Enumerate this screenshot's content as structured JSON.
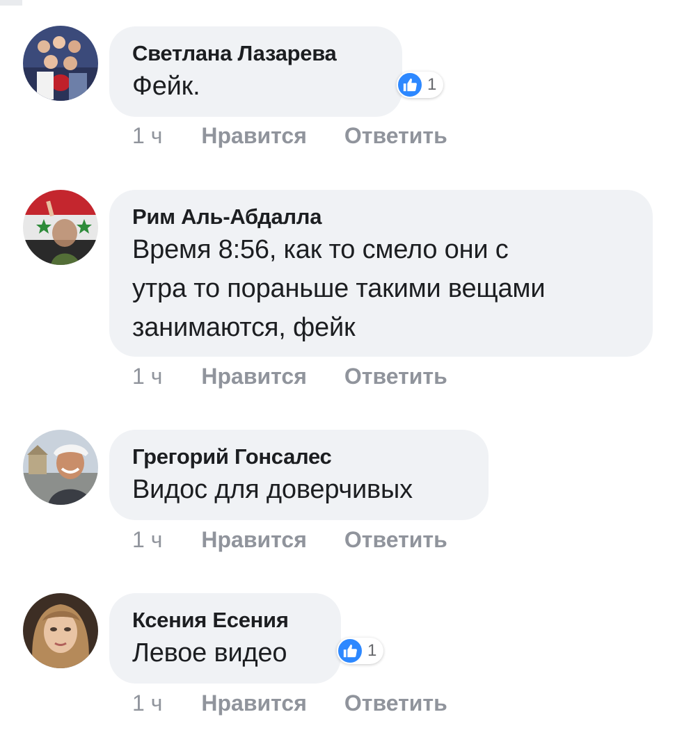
{
  "comments": [
    {
      "author": "Светлана Лазарева",
      "text": "Фейк.",
      "time": "1 ч",
      "like_label": "Нравится",
      "reply_label": "Ответить",
      "reactions": "1"
    },
    {
      "author": "Рим Аль-Абдалла",
      "text_lines": [
        "Время 8:56, как то смело они с",
        "утра то пораньше такими вещами",
        "занимаются, фейк"
      ],
      "time": "1 ч",
      "like_label": "Нравится",
      "reply_label": "Ответить"
    },
    {
      "author": "Грегорий Гонсалес",
      "text": "Видос для доверчивых",
      "time": "1 ч",
      "like_label": "Нравится",
      "reply_label": "Ответить"
    },
    {
      "author": "Ксения Есения",
      "text": "Левое видео",
      "time": "1 ч",
      "like_label": "Нравится",
      "reply_label": "Ответить",
      "reactions": "1"
    }
  ],
  "icons": {
    "reaction": "thumbs-up-icon"
  },
  "colors": {
    "bubble": "#f0f2f5",
    "meta": "#90949c",
    "like_blue": "#2d88ff"
  }
}
